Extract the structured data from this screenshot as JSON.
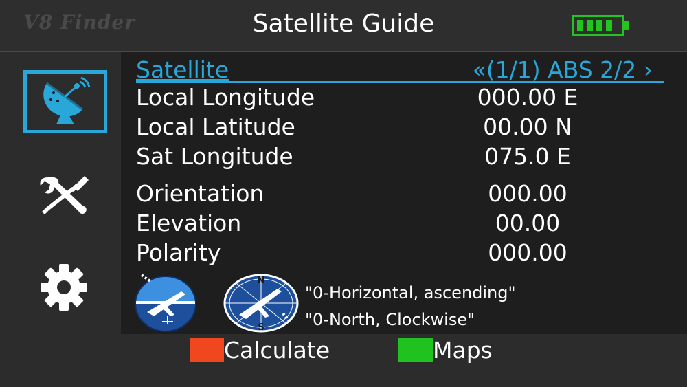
{
  "header": {
    "brand": "V8 Finder",
    "title": "Satellite Guide",
    "battery_icon": "battery-full-icon",
    "battery_color": "#22c41f"
  },
  "sidebar": {
    "items": [
      {
        "icon": "satellite-dish-icon",
        "selected": true
      },
      {
        "icon": "tools-icon",
        "selected": false
      },
      {
        "icon": "gear-icon",
        "selected": false
      }
    ]
  },
  "satellite": {
    "label": "Satellite",
    "prev_arrow": "«",
    "value": "(1/1) ABS 2/2",
    "next_arrow": "›"
  },
  "params": [
    {
      "label": "Local Longitude",
      "value": "000.00 E"
    },
    {
      "label": "Local Latitude",
      "value": "00.00 N"
    },
    {
      "label": "Sat Longitude",
      "value": "075.0 E"
    },
    {
      "label": "Orientation",
      "value": "000.00"
    },
    {
      "label": "Elevation",
      "value": "00.00"
    },
    {
      "label": "Polarity",
      "value": "000.00"
    }
  ],
  "info": {
    "compass_north": "N",
    "compass_south": "S",
    "elevation_note": "\"0-Horizontal, ascending\"",
    "orientation_note": "\"0-North, Clockwise\""
  },
  "footer": {
    "keys": [
      {
        "label": "Calculate",
        "color": "#f0481e"
      },
      {
        "label": "Maps",
        "color": "#1fc21f"
      }
    ]
  },
  "colors": {
    "accent": "#29a7d9",
    "background": "#1e1e1e",
    "panel": "#2c2c2c"
  }
}
